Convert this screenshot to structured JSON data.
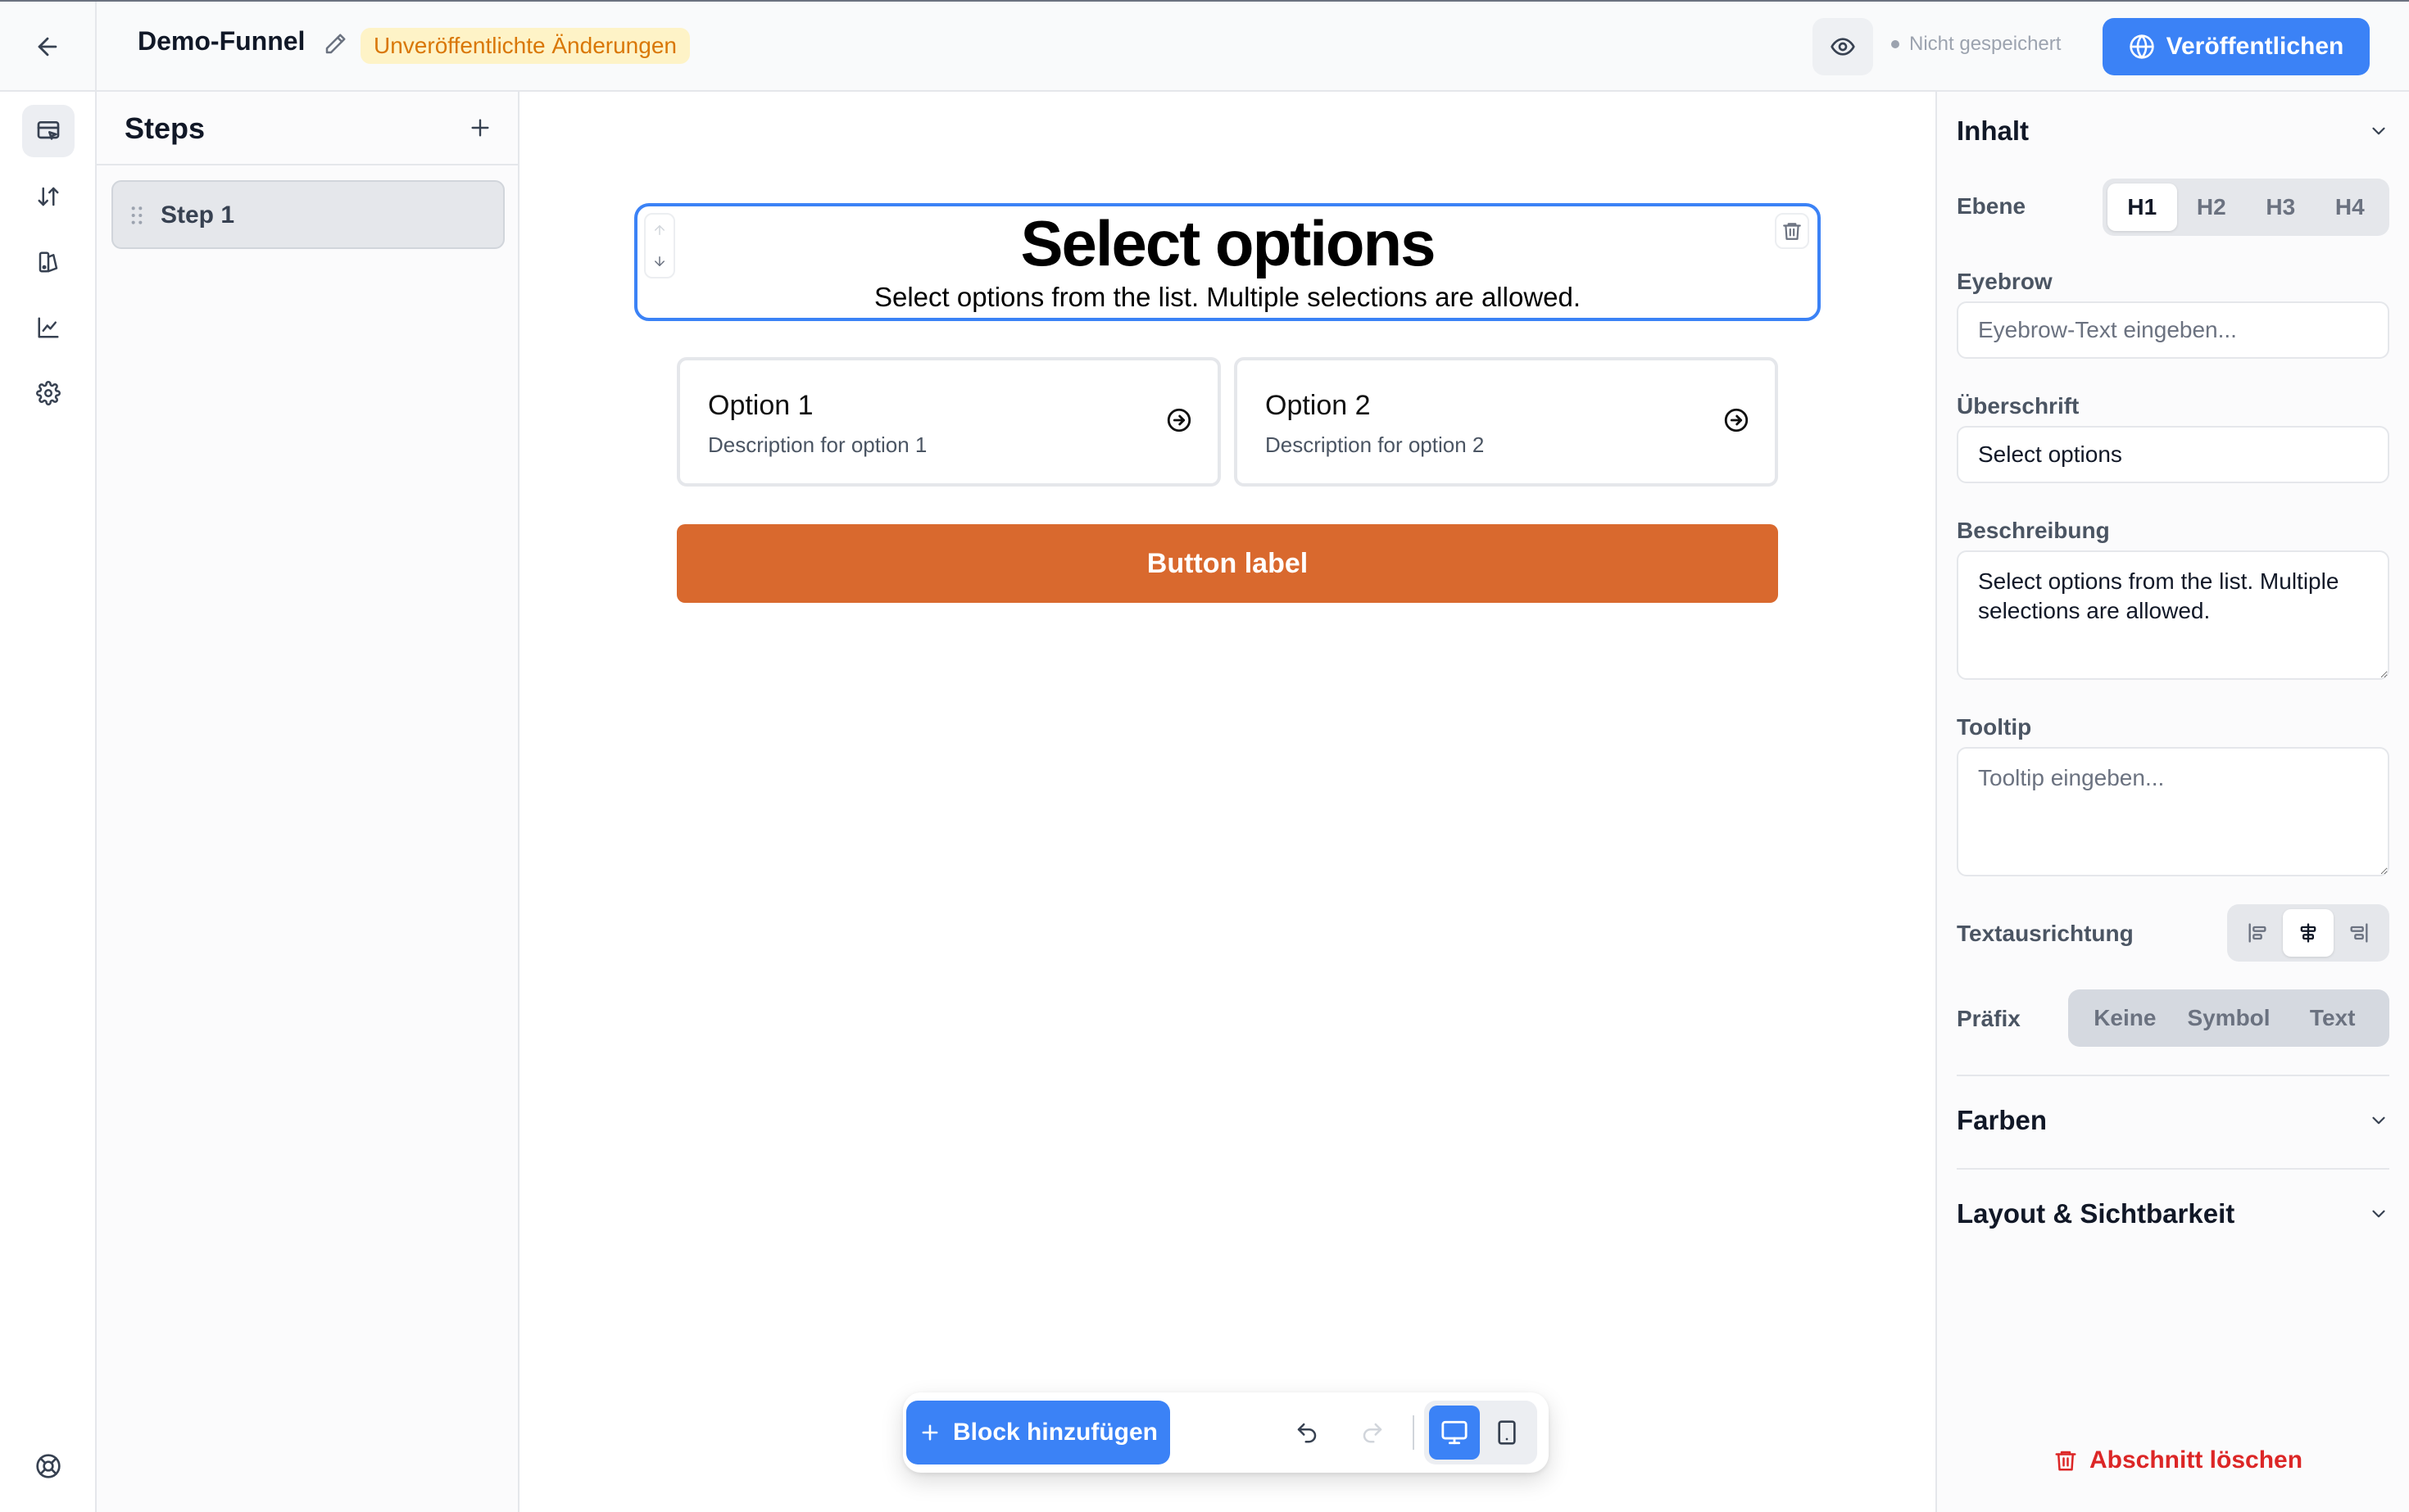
{
  "topbar": {
    "funnel_name": "Demo-Funnel",
    "unsaved_badge": "Unveröffentlichte Änderungen",
    "save_status": "Nicht gespeichert",
    "publish_label": "Veröffentlichen"
  },
  "rail": {
    "icons": [
      "editor-icon",
      "sort-icon",
      "design-icon",
      "analytics-icon",
      "settings-icon",
      "help-icon"
    ],
    "active": "editor-icon"
  },
  "steps": {
    "title": "Steps",
    "items": [
      {
        "label": "Step 1"
      }
    ]
  },
  "canvas": {
    "heading": "Select options",
    "description": "Select options from the list. Multiple selections are allowed.",
    "options": [
      {
        "title": "Option 1",
        "description": "Description for option 1"
      },
      {
        "title": "Option 2",
        "description": "Description for option 2"
      }
    ],
    "button_label": "Button label",
    "button_color": "#d9692e"
  },
  "toolbar": {
    "add_block_label": "Block hinzufügen",
    "device_selected": "desktop"
  },
  "props": {
    "content_section": "Inhalt",
    "level_label": "Ebene",
    "levels": [
      "H1",
      "H2",
      "H3",
      "H4"
    ],
    "level_selected": "H1",
    "eyebrow_label": "Eyebrow",
    "eyebrow_placeholder": "Eyebrow-Text eingeben...",
    "heading_label": "Überschrift",
    "heading_value": "Select options",
    "description_label": "Beschreibung",
    "description_value": "Select options from the list. Multiple selections are allowed.",
    "tooltip_label": "Tooltip",
    "tooltip_placeholder": "Tooltip eingeben...",
    "alignment_label": "Textausrichtung",
    "alignment_selected": "center",
    "prefix_label": "Präfix",
    "prefix_options": [
      "Keine",
      "Symbol",
      "Text"
    ],
    "colors_section": "Farben",
    "layout_section": "Layout & Sichtbarkeit",
    "delete_section_label": "Abschnitt löschen"
  },
  "colors": {
    "accent": "#3b82f6",
    "danger": "#dc2626",
    "warning_text": "#d97706",
    "warning_bg": "#fef3c7"
  }
}
